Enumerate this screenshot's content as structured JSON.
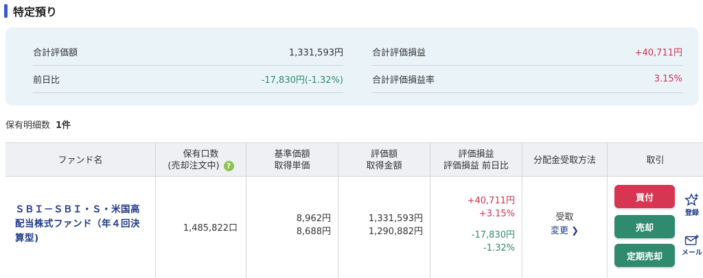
{
  "section": {
    "title": "特定預り"
  },
  "summary": {
    "total_value_label": "合計評価額",
    "total_value": "1,331,593円",
    "total_pl_label": "合計評価損益",
    "total_pl": "+40,711円",
    "day_change_label": "前日比",
    "day_change": "-17,830円(-1.32%)",
    "total_pl_rate_label": "合計評価損益率",
    "total_pl_rate": "3.15%"
  },
  "holdings": {
    "label": "保有明細数",
    "count": "1件"
  },
  "table": {
    "headers": {
      "fund": "ファンド名",
      "units_1": "保有口数",
      "units_2": "(売却注文中)",
      "price_1": "基準価額",
      "price_2": "取得単価",
      "value_1": "評価額",
      "value_2": "取得金額",
      "pl_1": "評価損益",
      "pl_2": "評価損益 前日比",
      "dist": "分配金受取方法",
      "trade": "取引"
    },
    "row": {
      "fund_name": "ＳＢＩ－ＳＢＩ・Ｓ・米国高配当株式ファンド（年４回決算型)",
      "units": "1,485,822口",
      "nav": "8,962円",
      "cost_unit": "8,688円",
      "value": "1,331,593円",
      "cost": "1,290,882円",
      "pl": "+40,711円",
      "pl_rate": "+3.15%",
      "day_pl": "-17,830円",
      "day_rate": "-1.32%",
      "dist_method": "受取",
      "change_link": "変更 ❯"
    },
    "buttons": {
      "buy": "買付",
      "sell": "売却",
      "periodic_sell": "定期売却"
    },
    "icons": {
      "register": "登録",
      "mail": "メール"
    }
  },
  "colors": {
    "accent": "#3a5bd0",
    "red": "#d0304f",
    "green": "#2f8a68",
    "buy": "#d63651",
    "sell": "#2f8a6e"
  }
}
